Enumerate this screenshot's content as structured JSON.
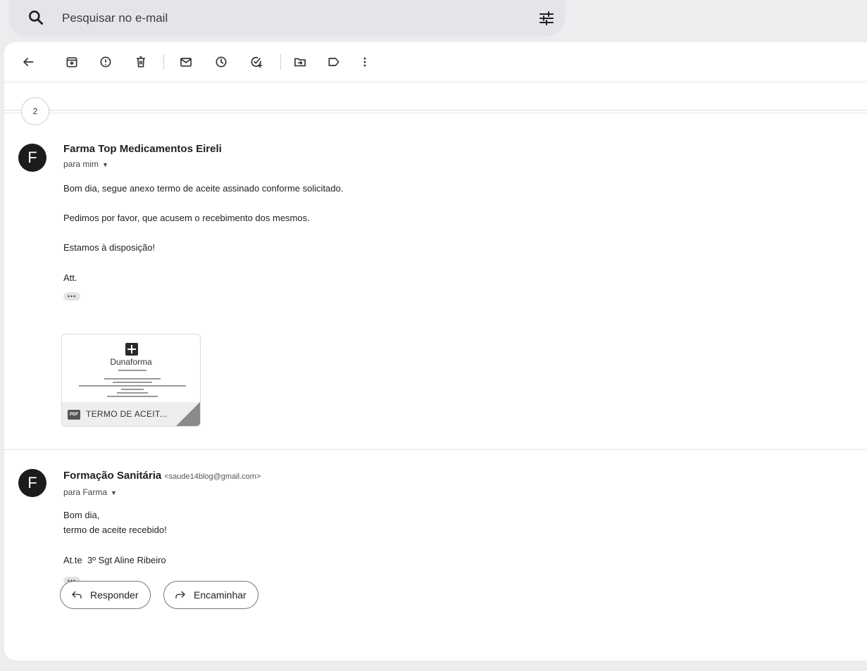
{
  "search": {
    "placeholder": "Pesquisar no e-mail"
  },
  "toolbar": {
    "icons": [
      "back-icon",
      "archive-icon",
      "report-spam-icon",
      "delete-icon",
      "mark-unread-icon",
      "snooze-icon",
      "add-to-tasks-icon",
      "move-to-icon",
      "label-icon",
      "more-icon"
    ]
  },
  "thread": {
    "collapsed_count": "2",
    "messages": [
      {
        "avatar_letter": "F",
        "sender_name": "Farma Top Medicamentos Eireli",
        "sender_email": "",
        "recipient": "para mim",
        "body": [
          "Bom dia, segue anexo termo de aceite assinado conforme solicitado.",
          "Pedimos por favor, que acusem o recebimento dos mesmos.",
          "Estamos à disposição!",
          "Att."
        ],
        "attachment": {
          "type_label": "PDF",
          "name": "TERMO DE ACEIT...",
          "preview_brand": "Dunaforma"
        }
      },
      {
        "avatar_letter": "F",
        "sender_name": "Formação Sanitária",
        "sender_email": "<saude14blog@gmail.com>",
        "recipient": "para Farma",
        "body": [
          "Bom dia,",
          "termo de aceite recebido!",
          "At.te  3º Sgt Aline Ribeiro"
        ]
      }
    ]
  },
  "actions": {
    "reply_label": "Responder",
    "forward_label": "Encaminhar"
  },
  "ellipsis": "•••",
  "colors": {
    "avatar": "#1c1c1c",
    "background": "#ecedef",
    "card": "#ffffff"
  }
}
